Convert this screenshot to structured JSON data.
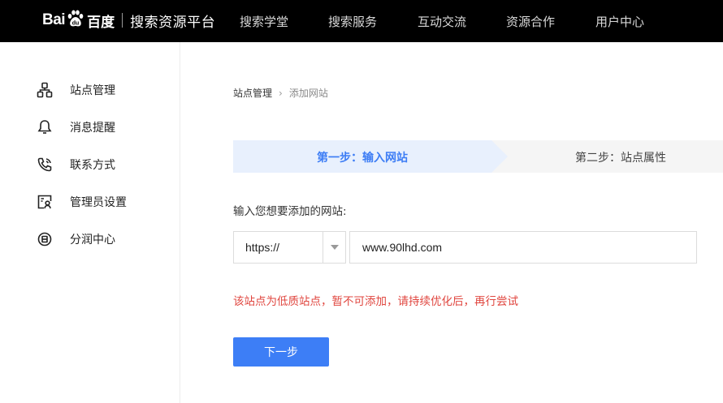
{
  "header": {
    "logo": {
      "bai": "Bai",
      "du": "du",
      "baidu_cn": "百度",
      "platform": "搜索资源平台"
    },
    "nav": [
      {
        "label": "搜索学堂"
      },
      {
        "label": "搜索服务"
      },
      {
        "label": "互动交流"
      },
      {
        "label": "资源合作"
      },
      {
        "label": "用户中心"
      }
    ]
  },
  "sidebar": {
    "items": [
      {
        "label": "站点管理",
        "icon": "site-structure-icon"
      },
      {
        "label": "消息提醒",
        "icon": "bell-icon"
      },
      {
        "label": "联系方式",
        "icon": "phone-icon"
      },
      {
        "label": "管理员设置",
        "icon": "admin-card-icon"
      },
      {
        "label": "分润中心",
        "icon": "revenue-coin-icon"
      }
    ]
  },
  "breadcrumb": {
    "parent": "站点管理",
    "separator": "›",
    "current": "添加网站"
  },
  "steps": [
    {
      "label": "第一步：输入网站",
      "active": true
    },
    {
      "label": "第二步：站点属性",
      "active": false
    }
  ],
  "form": {
    "label": "输入您想要添加的网站:",
    "protocol": "https://",
    "url_value": "www.90lhd.com",
    "error": "该站点为低质站点，暂不可添加，请持续优化后，再行尝试",
    "next_button": "下一步"
  },
  "colors": {
    "header_bg": "#000000",
    "accent": "#3d7ef6",
    "error": "#e0463f",
    "step_active_bg": "#e8f0fd"
  }
}
